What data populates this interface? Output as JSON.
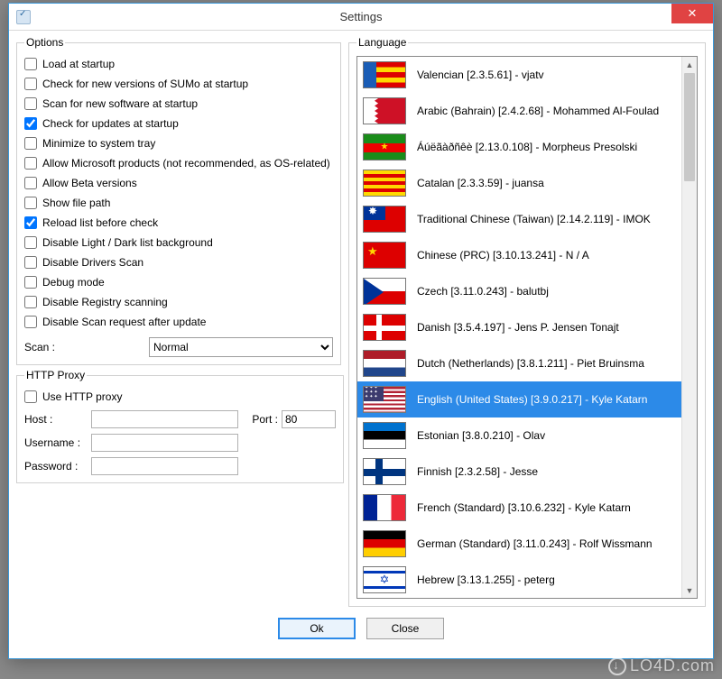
{
  "window": {
    "title": "Settings"
  },
  "options": {
    "legend": "Options",
    "items": [
      {
        "label": "Load at startup",
        "checked": false
      },
      {
        "label": "Check for new versions of SUMo at startup",
        "checked": false
      },
      {
        "label": "Scan for new software at startup",
        "checked": false
      },
      {
        "label": "Check for updates at startup",
        "checked": true
      },
      {
        "label": "Minimize to system tray",
        "checked": false
      },
      {
        "label": "Allow Microsoft products (not recommended, as OS-related)",
        "checked": false
      },
      {
        "label": "Allow Beta versions",
        "checked": false
      },
      {
        "label": "Show file path",
        "checked": false
      },
      {
        "label": "Reload list before check",
        "checked": true
      },
      {
        "label": "Disable Light / Dark list background",
        "checked": false
      },
      {
        "label": "Disable Drivers Scan",
        "checked": false
      },
      {
        "label": "Debug mode",
        "checked": false
      },
      {
        "label": "Disable Registry scanning",
        "checked": false
      },
      {
        "label": "Disable Scan request after update",
        "checked": false
      }
    ],
    "scan_label": "Scan :",
    "scan_value": "Normal"
  },
  "proxy": {
    "legend": "HTTP Proxy",
    "use_label": "Use HTTP proxy",
    "use_checked": false,
    "host_label": "Host :",
    "host_value": "",
    "port_label": "Port :",
    "port_value": "80",
    "user_label": "Username :",
    "user_value": "",
    "pass_label": "Password :",
    "pass_value": ""
  },
  "language": {
    "legend": "Language",
    "selected_index": 9,
    "items": [
      {
        "flag": "valencian",
        "label": "Valencian [2.3.5.61] - vjatv"
      },
      {
        "flag": "bahrain",
        "label": "Arabic (Bahrain) [2.4.2.68] - Mohammed Al-Foulad"
      },
      {
        "flag": "morpheus",
        "label": "Áúëãàðñêè [2.13.0.108] - Morpheus Presolski"
      },
      {
        "flag": "catalan",
        "label": "Catalan [2.3.3.59] - juansa"
      },
      {
        "flag": "tw",
        "label": "Traditional Chinese (Taiwan) [2.14.2.119] - IMOK"
      },
      {
        "flag": "prc",
        "label": "Chinese (PRC) [3.10.13.241] - N / A"
      },
      {
        "flag": "cz",
        "label": "Czech [3.11.0.243] - balutbj"
      },
      {
        "flag": "dk",
        "label": "Danish [3.5.4.197] - Jens P. Jensen Tonajt"
      },
      {
        "flag": "nl",
        "label": "Dutch (Netherlands) [3.8.1.211] - Piet Bruinsma"
      },
      {
        "flag": "us",
        "label": "English (United States) [3.9.0.217] - Kyle Katarn"
      },
      {
        "flag": "ee",
        "label": "Estonian [3.8.0.210] - Olav"
      },
      {
        "flag": "fi",
        "label": "Finnish [2.3.2.58] - Jesse"
      },
      {
        "flag": "fr",
        "label": "French (Standard) [3.10.6.232] - Kyle Katarn"
      },
      {
        "flag": "de",
        "label": "German (Standard) [3.11.0.243] - Rolf Wissmann"
      },
      {
        "flag": "il",
        "label": " Hebrew [3.13.1.255] - peterg"
      }
    ]
  },
  "buttons": {
    "ok": "Ok",
    "close": "Close"
  },
  "watermark": "LO4D.com"
}
